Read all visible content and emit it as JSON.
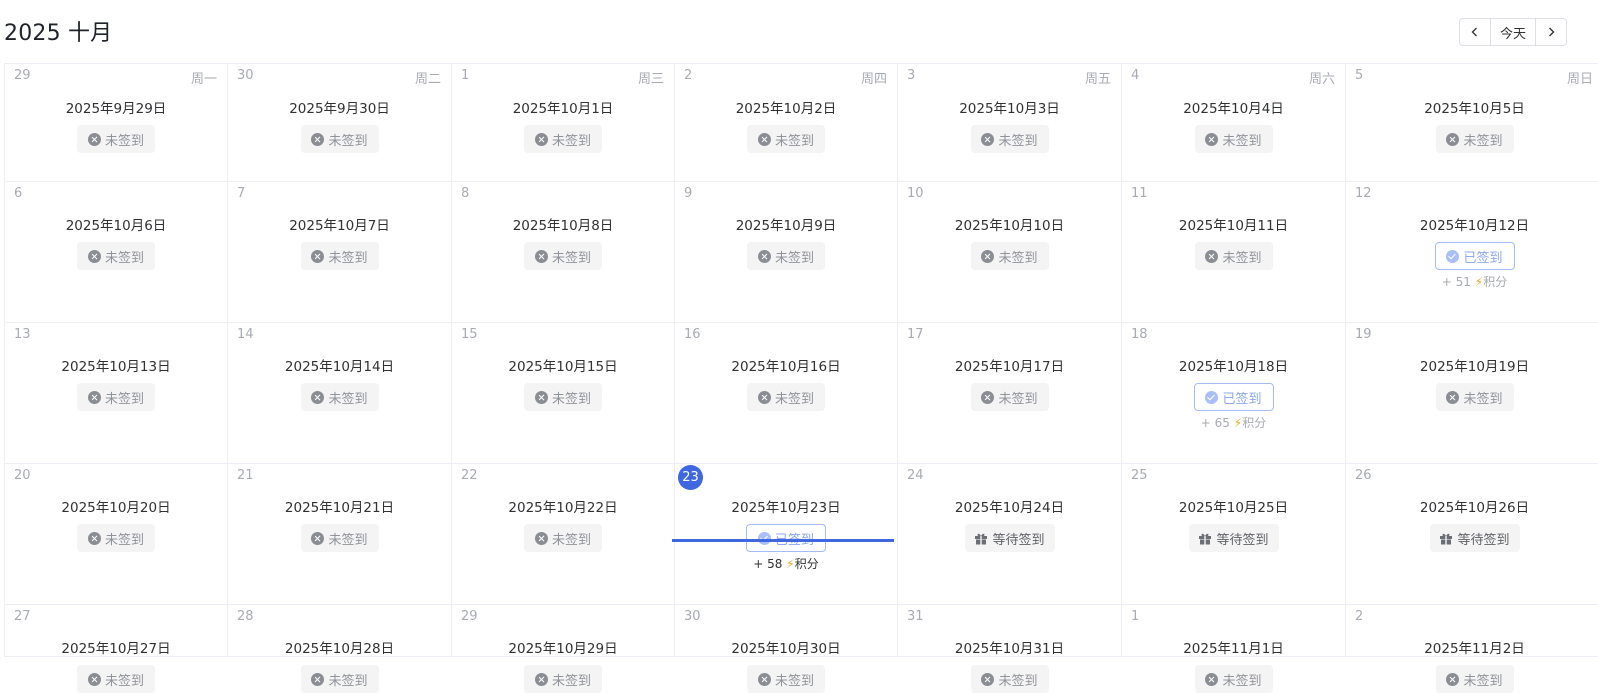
{
  "header": {
    "title": "2025 十月",
    "today_label": "今天",
    "prev_icon": "chevron-left-icon",
    "next_icon": "chevron-right-icon"
  },
  "status_labels": {
    "missed": "未签到",
    "signed": "已签到",
    "waiting": "等待签到",
    "points_suffix": "积分"
  },
  "weekdays": [
    "周一",
    "周二",
    "周三",
    "周四",
    "周五",
    "周六",
    "周日"
  ],
  "colors": {
    "accent": "#3f68e0",
    "signed_border": "#a5bcf5",
    "bolt": "#f5a623"
  },
  "weeks": [
    [
      {
        "day": "29",
        "date": "2025年9月29日",
        "status": "missed"
      },
      {
        "day": "30",
        "date": "2025年9月30日",
        "status": "missed"
      },
      {
        "day": "1",
        "date": "2025年10月1日",
        "status": "missed"
      },
      {
        "day": "2",
        "date": "2025年10月2日",
        "status": "missed"
      },
      {
        "day": "3",
        "date": "2025年10月3日",
        "status": "missed"
      },
      {
        "day": "4",
        "date": "2025年10月4日",
        "status": "missed"
      },
      {
        "day": "5",
        "date": "2025年10月5日",
        "status": "missed"
      }
    ],
    [
      {
        "day": "6",
        "date": "2025年10月6日",
        "status": "missed"
      },
      {
        "day": "7",
        "date": "2025年10月7日",
        "status": "missed"
      },
      {
        "day": "8",
        "date": "2025年10月8日",
        "status": "missed"
      },
      {
        "day": "9",
        "date": "2025年10月9日",
        "status": "missed"
      },
      {
        "day": "10",
        "date": "2025年10月10日",
        "status": "missed"
      },
      {
        "day": "11",
        "date": "2025年10月11日",
        "status": "missed"
      },
      {
        "day": "12",
        "date": "2025年10月12日",
        "status": "signed",
        "points": "+ 51"
      }
    ],
    [
      {
        "day": "13",
        "date": "2025年10月13日",
        "status": "missed"
      },
      {
        "day": "14",
        "date": "2025年10月14日",
        "status": "missed"
      },
      {
        "day": "15",
        "date": "2025年10月15日",
        "status": "missed"
      },
      {
        "day": "16",
        "date": "2025年10月16日",
        "status": "missed"
      },
      {
        "day": "17",
        "date": "2025年10月17日",
        "status": "missed"
      },
      {
        "day": "18",
        "date": "2025年10月18日",
        "status": "signed",
        "points": "+ 65"
      },
      {
        "day": "19",
        "date": "2025年10月19日",
        "status": "missed"
      }
    ],
    [
      {
        "day": "20",
        "date": "2025年10月20日",
        "status": "missed"
      },
      {
        "day": "21",
        "date": "2025年10月21日",
        "status": "missed"
      },
      {
        "day": "22",
        "date": "2025年10月22日",
        "status": "missed"
      },
      {
        "day": "23",
        "date": "2025年10月23日",
        "status": "signed",
        "points": "+ 58",
        "today": true
      },
      {
        "day": "24",
        "date": "2025年10月24日",
        "status": "waiting"
      },
      {
        "day": "25",
        "date": "2025年10月25日",
        "status": "waiting"
      },
      {
        "day": "26",
        "date": "2025年10月26日",
        "status": "waiting"
      }
    ],
    [
      {
        "day": "27",
        "date": "2025年10月27日",
        "status": "missed"
      },
      {
        "day": "28",
        "date": "2025年10月28日",
        "status": "missed"
      },
      {
        "day": "29",
        "date": "2025年10月29日",
        "status": "missed"
      },
      {
        "day": "30",
        "date": "2025年10月30日",
        "status": "missed"
      },
      {
        "day": "31",
        "date": "2025年10月31日",
        "status": "missed"
      },
      {
        "day": "1",
        "date": "2025年11月1日",
        "status": "missed"
      },
      {
        "day": "2",
        "date": "2025年11月2日",
        "status": "missed"
      }
    ]
  ]
}
